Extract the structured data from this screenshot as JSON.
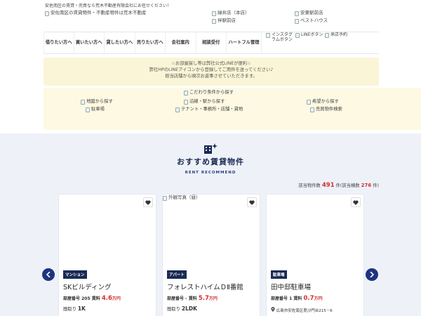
{
  "header": {
    "tagline": "安佐南区の賃貸・売買なら荒木不動産有限会社にお任せください！",
    "logo_alt": "安佐南区の賃貸物件・不動産物件は荒木不動産",
    "shops": [
      "緑井店（本店）",
      "安東駅前店",
      "伴駅前店",
      "ベストハウス"
    ]
  },
  "nav": {
    "items": [
      "借りたい方へ",
      "買いたい方へ",
      "貸したい方へ",
      "売りたい方へ",
      "会社案内",
      "相談受付",
      "ハートフル管理"
    ],
    "icons": [
      "インスタグラムボタン",
      "LINEボタン",
      "来店予約"
    ]
  },
  "notice": {
    "lines": [
      "☆お部屋探し等は弊社公式LINEが便利☆",
      "弊社HPのLINEアイコンから登録してご用件を送ってください♪",
      "担当店舗から順次お返事させていただきます。"
    ]
  },
  "search": {
    "kodawari": "こだわり条件から探す",
    "map": "地図から探す",
    "line": "沿線・駅から探す",
    "hope": "希望から探す",
    "parking": "駐車場",
    "tenant": "テナント・事務所・店舗・貸地",
    "sale": "売買物件検索"
  },
  "recommend": {
    "title": "おすすめ賃貸物件",
    "subtitle": "RENT RECOMMEND",
    "count_prefix": "該当物件数",
    "count_total": "491",
    "count_mid": "件(該当棟数",
    "count_buildings": "276",
    "count_suffix": "件)"
  },
  "cards": [
    {
      "image_alt": "",
      "type": "マンション",
      "name": "SKビルディング",
      "room_label": "部屋番号",
      "room": "205",
      "rent_label": "賃料",
      "rent": "4.6",
      "rent_unit": "万円",
      "layout_label": "間取り",
      "layout": "1K"
    },
    {
      "image_alt": "外観写真（昼）",
      "type": "アパート",
      "name": "フォレストハイムＤⅡ番館",
      "room_label": "部屋番号",
      "room": "-",
      "rent_label": "賃料",
      "rent": "5.7",
      "rent_unit": "万円",
      "layout_label": "間取り",
      "layout": "2LDK"
    },
    {
      "image_alt": "",
      "type": "駐車場",
      "name": "田中邸駐車場",
      "room_label": "部屋番号",
      "room": "1",
      "rent_label": "賃料",
      "rent": "0.7",
      "rent_unit": "万円",
      "address": "広島市安佐南区毘沙門台215－6"
    }
  ],
  "colors": {
    "navy": "#1a2a55",
    "accent_red": "#d32f2f",
    "notice_bg": "#fbf5d7",
    "section_bg": "#eef2f8"
  }
}
